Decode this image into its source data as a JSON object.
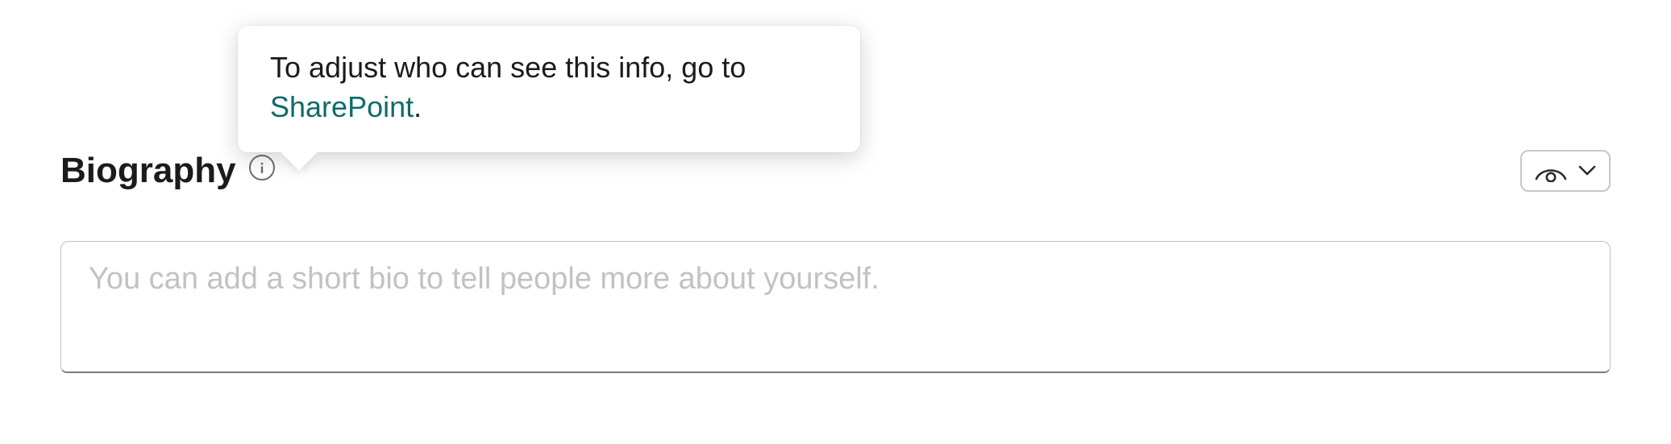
{
  "section": {
    "title": "Biography"
  },
  "tooltip": {
    "text": "To adjust who can see this info, go to ",
    "link_label": "SharePoint",
    "after": "."
  },
  "bio": {
    "value": "",
    "placeholder": "You can add a short bio to tell people more about yourself."
  }
}
